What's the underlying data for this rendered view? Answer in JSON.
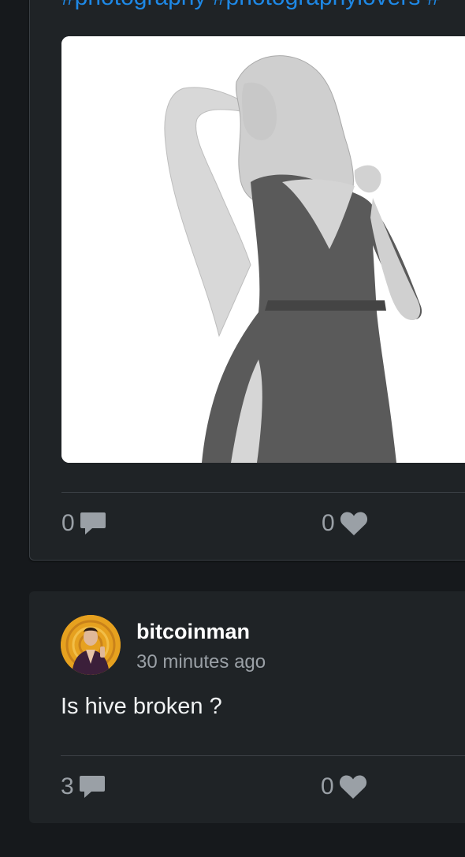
{
  "post1": {
    "hashtags": "#photography #photographylovers #",
    "comments": "0",
    "likes": "0"
  },
  "post2": {
    "author": "bitcoinman",
    "time": "30 minutes ago",
    "body": "Is hive broken ?",
    "comments": "3",
    "likes": "0"
  },
  "icons": {
    "comment": "comment-icon",
    "like": "heart-icon"
  },
  "colors": {
    "background": "#16191c",
    "card": "#1f2326",
    "hashtag": "#1e88e5",
    "muted": "#9aa0a6"
  }
}
